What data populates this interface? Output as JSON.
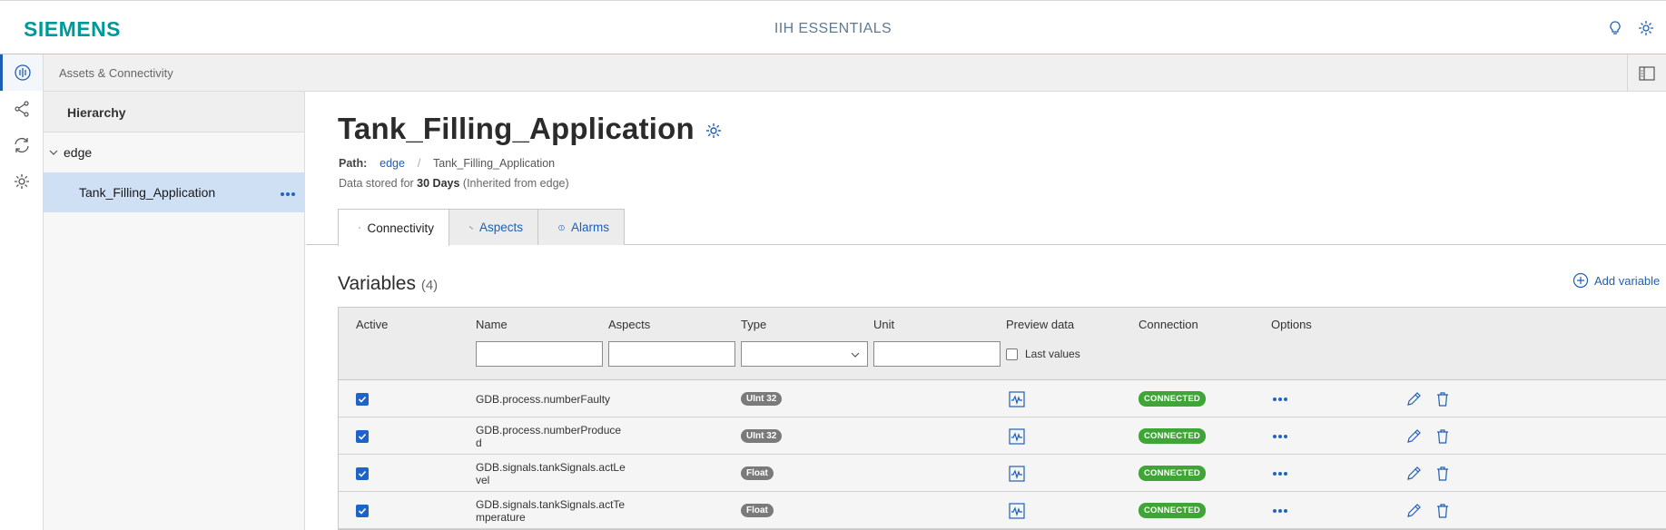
{
  "brand": "SIEMENS",
  "app_title": "IIH ESSENTIALS",
  "breadcrumb": "Assets & Connectivity",
  "tree": {
    "heading": "Hierarchy",
    "nodes": [
      {
        "label": "edge"
      },
      {
        "label": "Tank_Filling_Application"
      }
    ]
  },
  "asset": {
    "title": "Tank_Filling_Application",
    "path_label": "Path:",
    "path_root": "edge",
    "path_separator": "/",
    "path_current": "Tank_Filling_Application",
    "stored_prefix": "Data stored for",
    "stored_days": "30 Days",
    "stored_suffix": "(Inherited from edge)"
  },
  "tabs": [
    {
      "label": "Connectivity",
      "icon": "connectivity-icon",
      "active": true
    },
    {
      "label": "Aspects",
      "icon": "aspects-icon",
      "active": false
    },
    {
      "label": "Alarms",
      "icon": "alarm-icon",
      "active": false
    }
  ],
  "variables": {
    "title": "Variables",
    "count": "(4)",
    "add_label": "Add variable",
    "columns": {
      "active": "Active",
      "name": "Name",
      "aspects": "Aspects",
      "type": "Type",
      "unit": "Unit",
      "preview": "Preview data",
      "connection": "Connection",
      "options": "Options"
    },
    "last_values_label": "Last values",
    "rows": [
      {
        "name": "GDB.process.numberFaulty",
        "type": "UInt 32",
        "connection": "CONNECTED",
        "active": true
      },
      {
        "name": "GDB.process.numberProduced",
        "type": "UInt 32",
        "connection": "CONNECTED",
        "active": true
      },
      {
        "name": "GDB.signals.tankSignals.actLevel",
        "type": "Float",
        "connection": "CONNECTED",
        "active": true
      },
      {
        "name": "GDB.signals.tankSignals.actTemperature",
        "type": "Float",
        "connection": "CONNECTED",
        "active": true
      }
    ]
  },
  "colors": {
    "accent": "#1e64c8",
    "brand": "#009999",
    "connected": "#3fa536",
    "selected_row": "#cfe0f4"
  }
}
